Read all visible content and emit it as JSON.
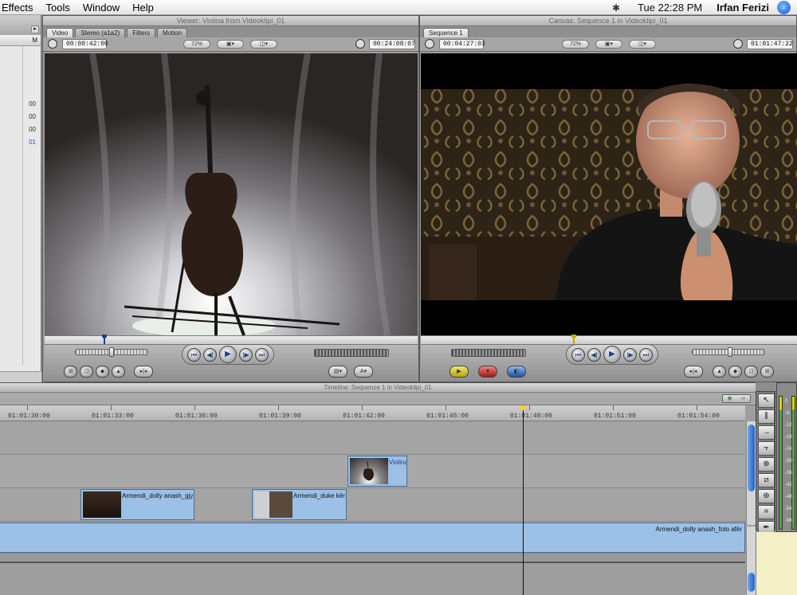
{
  "menubar": {
    "items": [
      "Effects",
      "Tools",
      "Window",
      "Help"
    ],
    "clock": "Tue 22:28 PM",
    "user": "Irfan  Ferizi"
  },
  "browser": {
    "column_header": "M",
    "numbers": [
      "00",
      "00",
      "00",
      "01"
    ]
  },
  "viewer": {
    "title": "Viewer: Violina from Videoklipi_01",
    "tabs": [
      "Video",
      "Stereo (a1a2)",
      "Filters",
      "Motion"
    ],
    "duration": "00:00:42:00",
    "zoom": "72%",
    "current_tc": "00:24:08:07"
  },
  "canvas": {
    "title": "Canvas: Sequence 1 in Videoklipi_01",
    "tabs": [
      "Sequence 1"
    ],
    "duration": "00:04:27:03",
    "zoom": "72%",
    "current_tc": "01:01:47:22"
  },
  "timeline": {
    "title": "Timeline: Sequence 1 in Videoklipi_01",
    "ticks": [
      "01:01:30:00",
      "01:01:33:00",
      "01:01:36:00",
      "01:01:39:00",
      "01:01:42:00",
      "01:01:45:00",
      "01:01:48:00",
      "01:01:51:00",
      "01:01:54:00"
    ],
    "clips": [
      {
        "label": "Violina"
      },
      {
        "label": "Armendi_dolly anash_gjy"
      },
      {
        "label": "Armendi_duke kër"
      },
      {
        "label": "Armendi_dolly anash_foto afër"
      }
    ]
  },
  "meters": {
    "scale": [
      "0",
      "-6",
      "-12",
      "-18",
      "-24",
      "-30",
      "-36",
      "-42",
      "-48",
      "-54",
      "-96"
    ]
  },
  "colors": {
    "clip_fill": "#9cc0e6",
    "playhead_cap": "#ffd400",
    "accent_blue": "#1d62c9"
  }
}
